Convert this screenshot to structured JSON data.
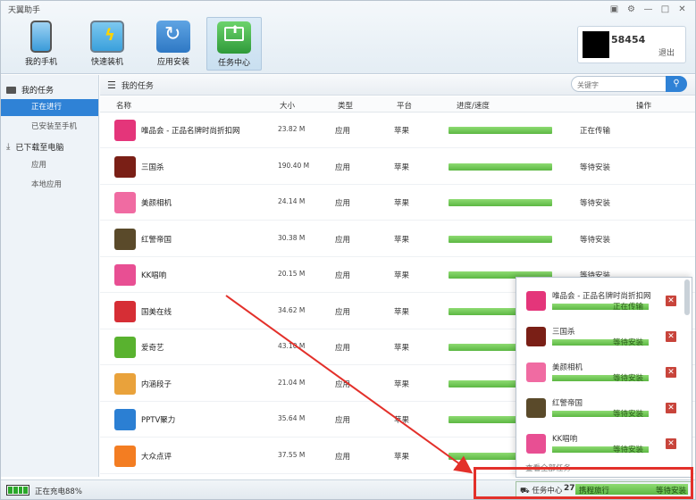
{
  "app": {
    "title": "天翼助手"
  },
  "window_controls": [
    "▣",
    "⚙",
    "—",
    "□",
    "✕"
  ],
  "toolbar": [
    {
      "label": "我的手机",
      "icon": "phone-icon",
      "color": "#3a9bd9"
    },
    {
      "label": "快速装机",
      "icon": "monitor-bolt-icon",
      "color": "#3aa0dc"
    },
    {
      "label": "应用安装",
      "icon": "refresh-install-icon",
      "color": "#2e78c4"
    },
    {
      "label": "任务中心",
      "icon": "task-box-icon",
      "color": "#3aa843"
    }
  ],
  "user": {
    "name": "58454",
    "logout": "退出"
  },
  "sidebar": {
    "my_tasks": "我的任务",
    "in_progress": "正在进行",
    "installed": "已安装至手机",
    "downloaded": "已下载至电脑",
    "apps": "应用",
    "local_apps": "本地应用"
  },
  "main": {
    "title": "我的任务",
    "search_placeholder": "关键字"
  },
  "columns": {
    "name": "名称",
    "size": "大小",
    "type": "类型",
    "platform": "平台",
    "progress": "进度/速度",
    "action": "操作"
  },
  "rows": [
    {
      "name": "唯品会 - 正品名牌时尚折扣网",
      "size": "23.82 M",
      "type": "应用",
      "platform": "苹果",
      "progress": 1,
      "status": "正在传输",
      "color": "#e4357a"
    },
    {
      "name": "三国杀",
      "size": "190.40 M",
      "type": "应用",
      "platform": "苹果",
      "progress": 1,
      "status": "等待安装",
      "color": "#7a1f16"
    },
    {
      "name": "美颜相机",
      "size": "24.14 M",
      "type": "应用",
      "platform": "苹果",
      "progress": 1,
      "status": "等待安装",
      "color": "#f06ba2"
    },
    {
      "name": "红警帝国",
      "size": "30.38 M",
      "type": "应用",
      "platform": "苹果",
      "progress": 1,
      "status": "等待安装",
      "color": "#5a4a2a"
    },
    {
      "name": "KK唱响",
      "size": "20.15 M",
      "type": "应用",
      "platform": "苹果",
      "progress": 1,
      "status": "等待安装",
      "color": "#e84f93"
    },
    {
      "name": "国美在线",
      "size": "34.62 M",
      "type": "应用",
      "platform": "苹果",
      "progress": 1,
      "status": "",
      "color": "#d62e35"
    },
    {
      "name": "爱奇艺",
      "size": "43.10 M",
      "type": "应用",
      "platform": "苹果",
      "progress": 1,
      "status": "",
      "color": "#59b22f"
    },
    {
      "name": "内涵段子",
      "size": "21.04 M",
      "type": "应用",
      "platform": "苹果",
      "progress": 1,
      "status": "",
      "color": "#e9a23b"
    },
    {
      "name": "PPTV聚力",
      "size": "35.64 M",
      "type": "应用",
      "platform": "苹果",
      "progress": 1,
      "status": "",
      "color": "#2b7fd3"
    },
    {
      "name": "大众点评",
      "size": "37.55 M",
      "type": "应用",
      "platform": "苹果",
      "progress": 1,
      "status": "",
      "color": "#f37d22"
    }
  ],
  "panel": {
    "items": [
      {
        "name": "唯品会 - 正品名牌时尚折扣网",
        "status": "正在传输",
        "color": "#e4357a"
      },
      {
        "name": "三国杀",
        "status": "等待安装",
        "color": "#7a1f16"
      },
      {
        "name": "美颜相机",
        "status": "等待安装",
        "color": "#f06ba2"
      },
      {
        "name": "红警帝国",
        "status": "等待安装",
        "color": "#5a4a2a"
      },
      {
        "name": "KK唱响",
        "status": "等待安装",
        "color": "#e84f93"
      }
    ],
    "view_all": "查看全部任务"
  },
  "taskbar": {
    "label": "任务中心",
    "count": "27",
    "current": "携程旅行",
    "state": "等待安装"
  },
  "status": {
    "charging": "正在充电88%"
  },
  "accent": "#2f82d6",
  "highlight_color": "#e3302a"
}
